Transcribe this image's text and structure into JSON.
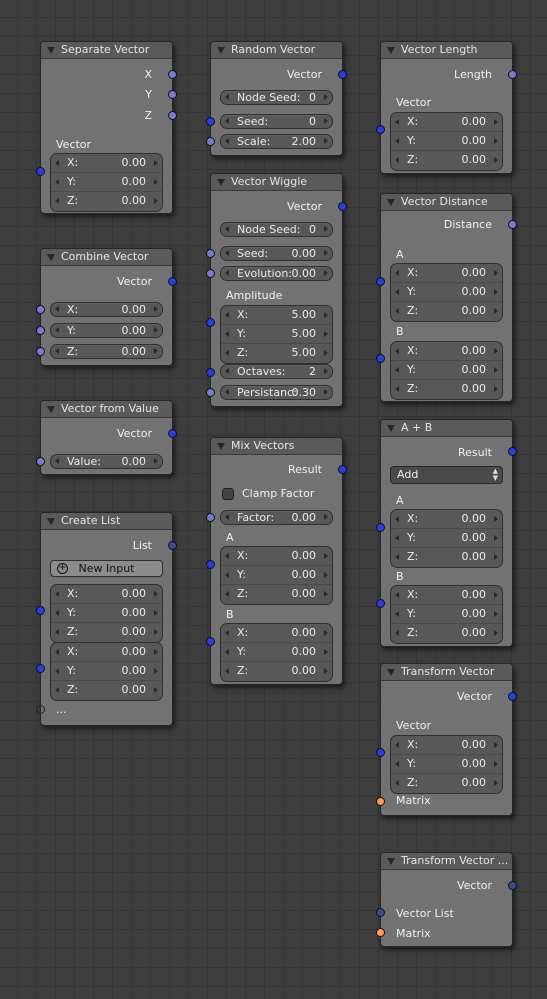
{
  "nodes": {
    "separate_vector": {
      "title": "Separate Vector",
      "out_x": "X",
      "out_y": "Y",
      "out_z": "Z",
      "in_label": "Vector",
      "fields": [
        {
          "label": "X:",
          "value": "0.00"
        },
        {
          "label": "Y:",
          "value": "0.00"
        },
        {
          "label": "Z:",
          "value": "0.00"
        }
      ]
    },
    "random_vector": {
      "title": "Random Vector",
      "out": "Vector",
      "node_seed": {
        "label": "Node Seed:",
        "value": "0"
      },
      "seed": {
        "label": "Seed:",
        "value": "0"
      },
      "scale": {
        "label": "Scale:",
        "value": "2.00"
      }
    },
    "vector_length": {
      "title": "Vector Length",
      "out": "Length",
      "in_label": "Vector",
      "fields": [
        {
          "label": "X:",
          "value": "0.00"
        },
        {
          "label": "Y:",
          "value": "0.00"
        },
        {
          "label": "Z:",
          "value": "0.00"
        }
      ]
    },
    "combine_vector": {
      "title": "Combine Vector",
      "out": "Vector",
      "fields": [
        {
          "label": "X:",
          "value": "0.00"
        },
        {
          "label": "Y:",
          "value": "0.00"
        },
        {
          "label": "Z:",
          "value": "0.00"
        }
      ]
    },
    "vector_wiggle": {
      "title": "Vector Wiggle",
      "out": "Vector",
      "node_seed": {
        "label": "Node Seed:",
        "value": "0"
      },
      "seed": {
        "label": "Seed:",
        "value": "0.00"
      },
      "evolution": {
        "label": "Evolution:",
        "value": "0.00"
      },
      "amplitude_label": "Amplitude",
      "amplitude": [
        {
          "label": "X:",
          "value": "5.00"
        },
        {
          "label": "Y:",
          "value": "5.00"
        },
        {
          "label": "Z:",
          "value": "5.00"
        }
      ],
      "octaves": {
        "label": "Octaves:",
        "value": "2"
      },
      "persistance": {
        "label": "Persistanc:",
        "value": "0.30"
      }
    },
    "vector_distance": {
      "title": "Vector Distance",
      "out": "Distance",
      "a_label": "A",
      "a": [
        {
          "label": "X:",
          "value": "0.00"
        },
        {
          "label": "Y:",
          "value": "0.00"
        },
        {
          "label": "Z:",
          "value": "0.00"
        }
      ],
      "b_label": "B",
      "b": [
        {
          "label": "X:",
          "value": "0.00"
        },
        {
          "label": "Y:",
          "value": "0.00"
        },
        {
          "label": "Z:",
          "value": "0.00"
        }
      ]
    },
    "vector_from_value": {
      "title": "Vector from Value",
      "out": "Vector",
      "value": {
        "label": "Value:",
        "value": "0.00"
      }
    },
    "mix_vectors": {
      "title": "Mix Vectors",
      "out": "Result",
      "clamp_label": "Clamp Factor",
      "factor": {
        "label": "Factor:",
        "value": "0.00"
      },
      "a_label": "A",
      "a": [
        {
          "label": "X:",
          "value": "0.00"
        },
        {
          "label": "Y:",
          "value": "0.00"
        },
        {
          "label": "Z:",
          "value": "0.00"
        }
      ],
      "b_label": "B",
      "b": [
        {
          "label": "X:",
          "value": "0.00"
        },
        {
          "label": "Y:",
          "value": "0.00"
        },
        {
          "label": "Z:",
          "value": "0.00"
        }
      ]
    },
    "a_plus_b": {
      "title": "A + B",
      "out": "Result",
      "operation": "Add",
      "a_label": "A",
      "a": [
        {
          "label": "X:",
          "value": "0.00"
        },
        {
          "label": "Y:",
          "value": "0.00"
        },
        {
          "label": "Z:",
          "value": "0.00"
        }
      ],
      "b_label": "B",
      "b": [
        {
          "label": "X:",
          "value": "0.00"
        },
        {
          "label": "Y:",
          "value": "0.00"
        },
        {
          "label": "Z:",
          "value": "0.00"
        }
      ]
    },
    "create_list": {
      "title": "Create List",
      "out": "List",
      "new_input": "New Input",
      "item1": [
        {
          "label": "X:",
          "value": "0.00"
        },
        {
          "label": "Y:",
          "value": "0.00"
        },
        {
          "label": "Z:",
          "value": "0.00"
        }
      ],
      "item2": [
        {
          "label": "X:",
          "value": "0.00"
        },
        {
          "label": "Y:",
          "value": "0.00"
        },
        {
          "label": "Z:",
          "value": "0.00"
        }
      ],
      "ellipsis": "..."
    },
    "transform_vector": {
      "title": "Transform Vector",
      "out": "Vector",
      "in_label": "Vector",
      "fields": [
        {
          "label": "X:",
          "value": "0.00"
        },
        {
          "label": "Y:",
          "value": "0.00"
        },
        {
          "label": "Z:",
          "value": "0.00"
        }
      ],
      "matrix_label": "Matrix"
    },
    "transform_vector_list": {
      "title": "Transform Vector ...",
      "out": "Vector",
      "vector_list_label": "Vector List",
      "matrix_label": "Matrix"
    }
  },
  "colors": {
    "vector_socket": "#2a3ee0",
    "float_socket": "#7a7ad4",
    "matrix_socket": "#ff9a50",
    "node_body": "#727272",
    "node_header": "#5a5a5a",
    "background": "#3d3d3d"
  }
}
